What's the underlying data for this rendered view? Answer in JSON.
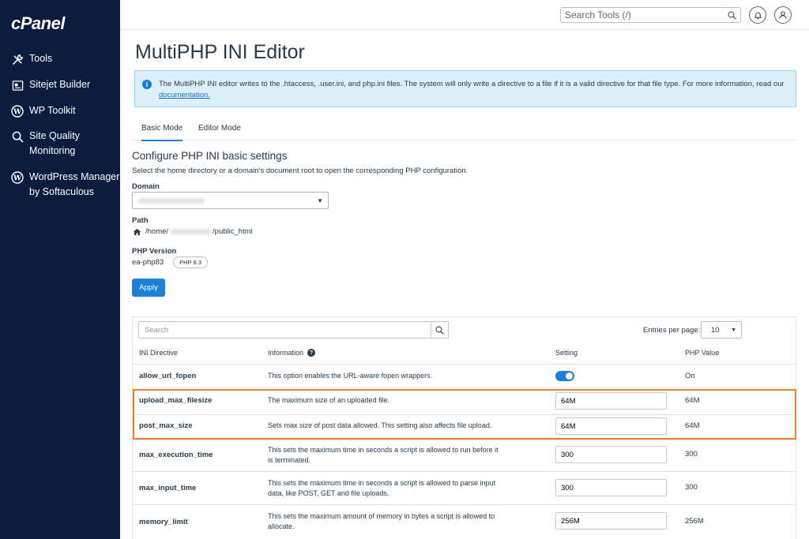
{
  "brand": {
    "logo": "cPanel"
  },
  "sidebar": {
    "items": [
      {
        "label": "Tools",
        "icon": "tools-icon"
      },
      {
        "label": "Sitejet Builder",
        "icon": "sitejet-icon"
      },
      {
        "label": "WP Toolkit",
        "icon": "wordpress-icon"
      },
      {
        "label": "Site Quality",
        "label2": "Monitoring",
        "icon": "search-icon"
      },
      {
        "label": "WordPress Manager",
        "label2": "by Softaculous",
        "icon": "wordpress-icon"
      }
    ]
  },
  "topbar": {
    "search_placeholder": "Search Tools (/)"
  },
  "page": {
    "title": "MultiPHP INI Editor",
    "alert_text": "The MultiPHP INI editor writes to the .htaccess, .user.ini, and php.ini files. The system will only write a directive to a file if it is a valid directive for that file type. For more information, read our",
    "alert_link": "documentation."
  },
  "tabs": [
    {
      "label": "Basic Mode",
      "active": true
    },
    {
      "label": "Editor Mode",
      "active": false
    }
  ],
  "config": {
    "title": "Configure PHP INI basic settings",
    "description": "Select the home directory or a domain’s document root to open the corresponding PHP configuration.",
    "domain_label": "Domain",
    "path_label": "Path",
    "path_prefix": "/home/",
    "path_suffix": "/public_html",
    "php_version_label": "PHP Version",
    "php_version_value": "ea-php83",
    "php_version_badge": "PHP 8.3",
    "apply_label": "Apply"
  },
  "table": {
    "search_placeholder": "Search",
    "entries_label": "Entries per page:",
    "entries_value": "10",
    "headers": {
      "directive": "INI Directive",
      "information": "Information",
      "setting": "Setting",
      "php_value": "PHP Value"
    },
    "rows": [
      {
        "directive": "allow_url_fopen",
        "info": "This option enables the URL-aware fopen wrappers.",
        "setting": "toggle-on",
        "php_value": "On"
      },
      {
        "directive": "upload_max_filesize",
        "info": "The maximum size of an uploaded file.",
        "setting": "64M",
        "php_value": "64M"
      },
      {
        "directive": "post_max_size",
        "info": "Sets max size of post data allowed. This setting also affects file upload.",
        "setting": "64M",
        "php_value": "64M"
      },
      {
        "directive": "max_execution_time",
        "info": "This sets the maximum time in seconds a script is allowed to run before it is terminated.",
        "setting": "300",
        "php_value": "300"
      },
      {
        "directive": "max_input_time",
        "info": "This sets the maximum time in seconds a script is allowed to parse input data, like POST, GET and file uploads.",
        "setting": "300",
        "php_value": "300"
      },
      {
        "directive": "memory_limit",
        "info": "This sets the maximum amount of memory in bytes a script is allowed to allocate.",
        "setting": "256M",
        "php_value": "256M"
      }
    ]
  },
  "colors": {
    "sidebar_bg": "#0b1c3f",
    "accent": "#1b80d8",
    "highlight": "#f07f36",
    "alert_bg": "#dcf0fb"
  }
}
